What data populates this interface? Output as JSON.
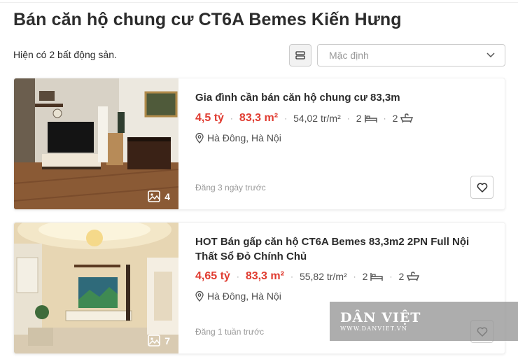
{
  "page": {
    "title": "Bán căn hộ chung cư CT6A Bemes Kiến Hưng",
    "count_text": "Hiện có 2 bất động sản.",
    "sort_value": "Mặc định"
  },
  "listings": [
    {
      "title": "Gia đình cần bán căn hộ chung cư 83,3m",
      "price": "4,5 tỷ",
      "area": "83,3 m²",
      "price_per_m2": "54,02 tr/m²",
      "bedrooms": "2",
      "bathrooms": "2",
      "location": "Hà Đông, Hà Nội",
      "posted": "Đăng 3 ngày trước",
      "photo_count": "4"
    },
    {
      "title": "HOT Bán gấp căn hộ CT6A Bemes 83,3m2 2PN Full Nội Thất Sổ Đỏ Chính Chủ",
      "price": "4,65 tỷ",
      "area": "83,3 m²",
      "price_per_m2": "55,82 tr/m²",
      "bedrooms": "2",
      "bathrooms": "2",
      "location": "Hà Đông, Hà Nội",
      "posted": "Đăng 1 tuần trước",
      "photo_count": "7"
    }
  ],
  "watermark": {
    "brand": "DÂN VIỆT",
    "url": "WWW.DANVIET.VN"
  },
  "separator": "·",
  "icons": [
    "list-view-icon",
    "chevron-down-icon",
    "image-gallery-icon",
    "bed-icon",
    "bath-icon",
    "location-pin-icon",
    "heart-icon"
  ],
  "colors": {
    "accent": "#e03c31",
    "text": "#2c2c2c",
    "muted": "#999999"
  }
}
